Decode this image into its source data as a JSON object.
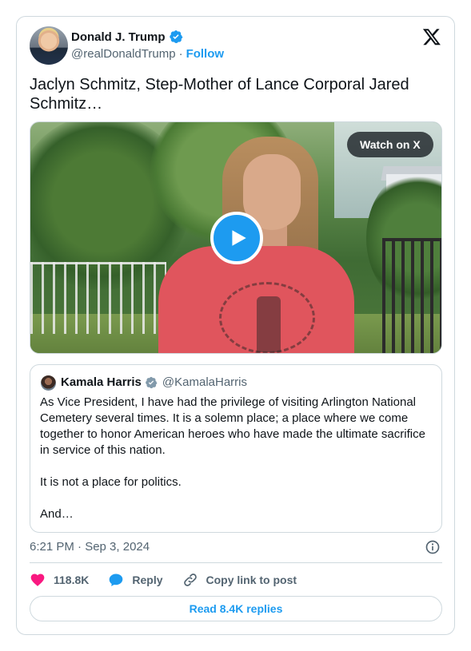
{
  "author": {
    "name": "Donald J. Trump",
    "handle": "@realDonaldTrump",
    "separator": "·",
    "follow_label": "Follow"
  },
  "tweet": {
    "text": "Jaclyn Schmitz, Step-Mother of Lance Corporal Jared Schmitz…"
  },
  "media": {
    "watch_label": "Watch on X"
  },
  "quoted": {
    "name": "Kamala Harris",
    "handle": "@KamalaHarris",
    "paragraphs": [
      "As Vice President, I have had the privilege of visiting Arlington National Cemetery several times. It is a solemn place; a place where we come together to honor American heroes who have made the ultimate sacrifice in service of this nation.",
      "It is not a place for politics.",
      "And…"
    ]
  },
  "timestamp": "6:21 PM · Sep 3, 2024",
  "actions": {
    "likes": "118.8K",
    "reply_label": "Reply",
    "copy_label": "Copy link to post"
  },
  "replies_button": "Read 8.4K replies",
  "colors": {
    "accent": "#1d9bf0",
    "heart": "#f91880",
    "text": "#0f1419",
    "muted": "#536471",
    "border": "#cfd9de"
  }
}
